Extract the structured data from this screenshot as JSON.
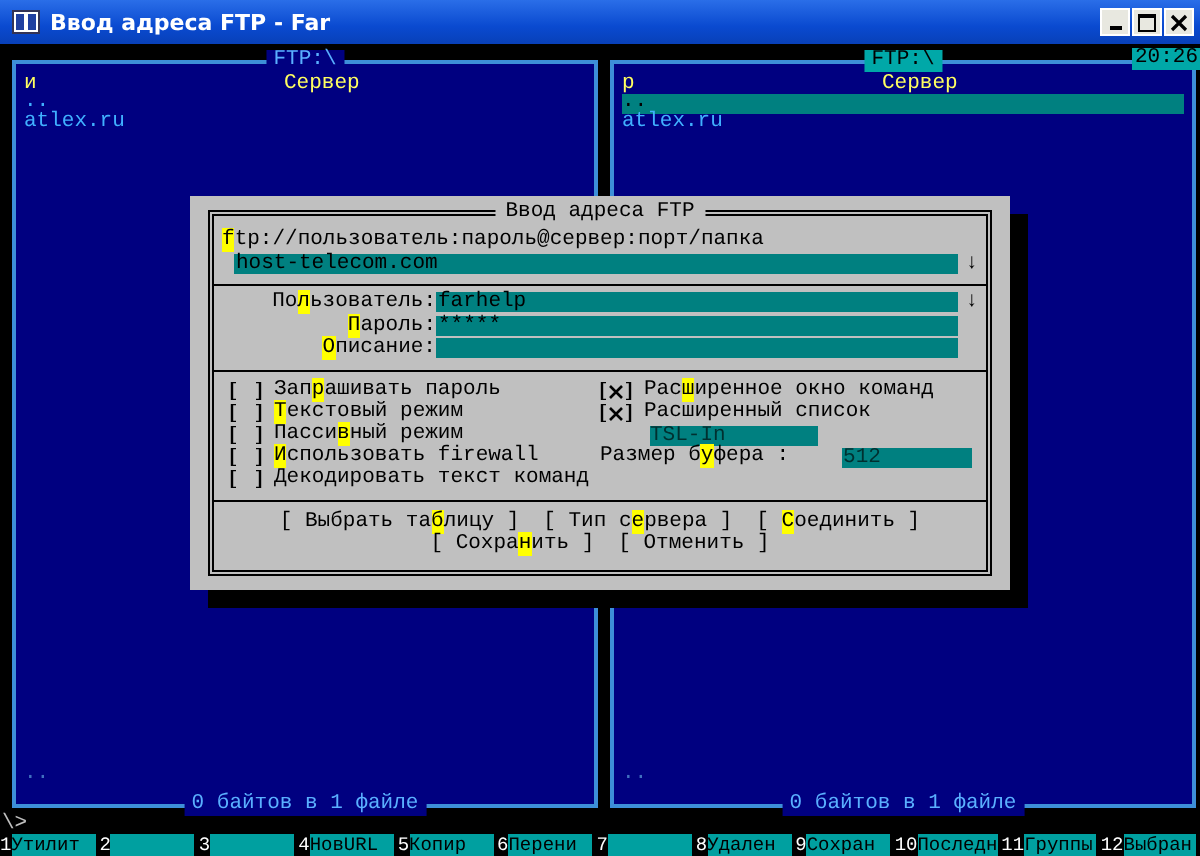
{
  "window": {
    "title": "Ввод адреса FTP - Far"
  },
  "clock": "20:26",
  "panels": [
    {
      "title": "FTP:\\",
      "active": false,
      "column_1": "и",
      "column_2": "Сервер",
      "rows": [
        {
          "name": "..",
          "selected": false
        },
        {
          "name": "atlex.ru",
          "selected": false
        }
      ],
      "bottom_row": "..",
      "status": "0 байтов в 1 файле"
    },
    {
      "title": "FTP:\\",
      "active": true,
      "column_1": "р",
      "column_2": "Сервер",
      "rows": [
        {
          "name": "..",
          "selected": true
        },
        {
          "name": "atlex.ru",
          "selected": false
        }
      ],
      "bottom_row": "..",
      "status": "0 байтов в 1 файле"
    }
  ],
  "dialog": {
    "title": "Ввод адреса FTP",
    "url_label": [
      {
        "t": "f",
        "hot": true
      },
      {
        "t": "tp://пользователь:пароль@сервер:порт/папка",
        "hot": false
      }
    ],
    "url_value": "host-telecom.com",
    "url_history": "↓",
    "fields": [
      {
        "label": [
          {
            "t": "По",
            "hot": false
          },
          {
            "t": "л",
            "hot": true
          },
          {
            "t": "ьзователь:",
            "hot": false
          }
        ],
        "value": "farhelp",
        "history": "↓"
      },
      {
        "label": [
          {
            "t": "П",
            "hot": true
          },
          {
            "t": "ароль:",
            "hot": false
          }
        ],
        "value": "*****"
      },
      {
        "label": [
          {
            "t": "О",
            "hot": true
          },
          {
            "t": "писание:",
            "hot": false
          }
        ]
      }
    ],
    "options_left": [
      {
        "label": [
          {
            "t": "Зап",
            "hot": false
          },
          {
            "t": "р",
            "hot": true
          },
          {
            "t": "ашивать пароль",
            "hot": false
          }
        ],
        "checked": false
      },
      {
        "label": [
          {
            "t": "Т",
            "hot": true
          },
          {
            "t": "екстовый режим",
            "hot": false
          }
        ],
        "checked": false
      },
      {
        "label": [
          {
            "t": "Пасси",
            "hot": false
          },
          {
            "t": "в",
            "hot": true
          },
          {
            "t": "ный режим",
            "hot": false
          }
        ],
        "checked": false
      },
      {
        "label": [
          {
            "t": "И",
            "hot": true
          },
          {
            "t": "спользовать firewall",
            "hot": false
          }
        ],
        "checked": false
      },
      {
        "label": [
          {
            "t": "Декодировать текст команд",
            "hot": false
          }
        ],
        "checked": false
      }
    ],
    "options_right": [
      {
        "kind": "checkbox",
        "label": [
          {
            "t": "Рас",
            "hot": false
          },
          {
            "t": "ш",
            "hot": true
          },
          {
            "t": "иренное окно команд",
            "hot": false
          }
        ],
        "checked": true
      },
      {
        "kind": "checkbox",
        "label": [
          {
            "t": "Расширенный список",
            "hot": false
          }
        ],
        "checked": true
      },
      {
        "kind": "combo",
        "value": "TSL-In"
      },
      {
        "kind": "input",
        "label": [
          {
            "t": "Размер б",
            "hot": false
          },
          {
            "t": "у",
            "hot": true
          },
          {
            "t": "фера  :",
            "hot": false
          }
        ],
        "value": "512"
      }
    ],
    "button_rows": [
      [
        {
          "label": [
            {
              "t": "[ Выбрать та",
              "hot": false
            },
            {
              "t": "б",
              "hot": true
            },
            {
              "t": "лицу ]",
              "hot": false
            }
          ]
        },
        {
          "label": [
            {
              "t": "[ Тип с",
              "hot": false
            },
            {
              "t": "е",
              "hot": true
            },
            {
              "t": "рвера ]",
              "hot": false
            }
          ]
        },
        {
          "label": [
            {
              "t": "[ ",
              "hot": false
            },
            {
              "t": "С",
              "hot": true
            },
            {
              "t": "оединить ]",
              "hot": false
            }
          ]
        }
      ],
      [
        {
          "label": [
            {
              "t": "[ Сохра",
              "hot": false
            },
            {
              "t": "н",
              "hot": true
            },
            {
              "t": "ить ]",
              "hot": false
            }
          ]
        },
        {
          "label": [
            {
              "t": "[ Отменить ]",
              "hot": false
            }
          ]
        }
      ]
    ]
  },
  "command_prompt": "\\>",
  "keybar": [
    {
      "number": "1",
      "label": "Утилит"
    },
    {
      "number": "2"
    },
    {
      "number": "3"
    },
    {
      "number": "4",
      "label": "НовURL"
    },
    {
      "number": "5",
      "label": "Копир"
    },
    {
      "number": "6",
      "label": "Перени"
    },
    {
      "number": "7"
    },
    {
      "number": "8",
      "label": "Удален"
    },
    {
      "number": "9",
      "label": "Сохран"
    },
    {
      "number": "10",
      "label": "Последн"
    },
    {
      "number": "11",
      "label": "Группы"
    },
    {
      "number": "12",
      "label": "Выбран"
    }
  ]
}
